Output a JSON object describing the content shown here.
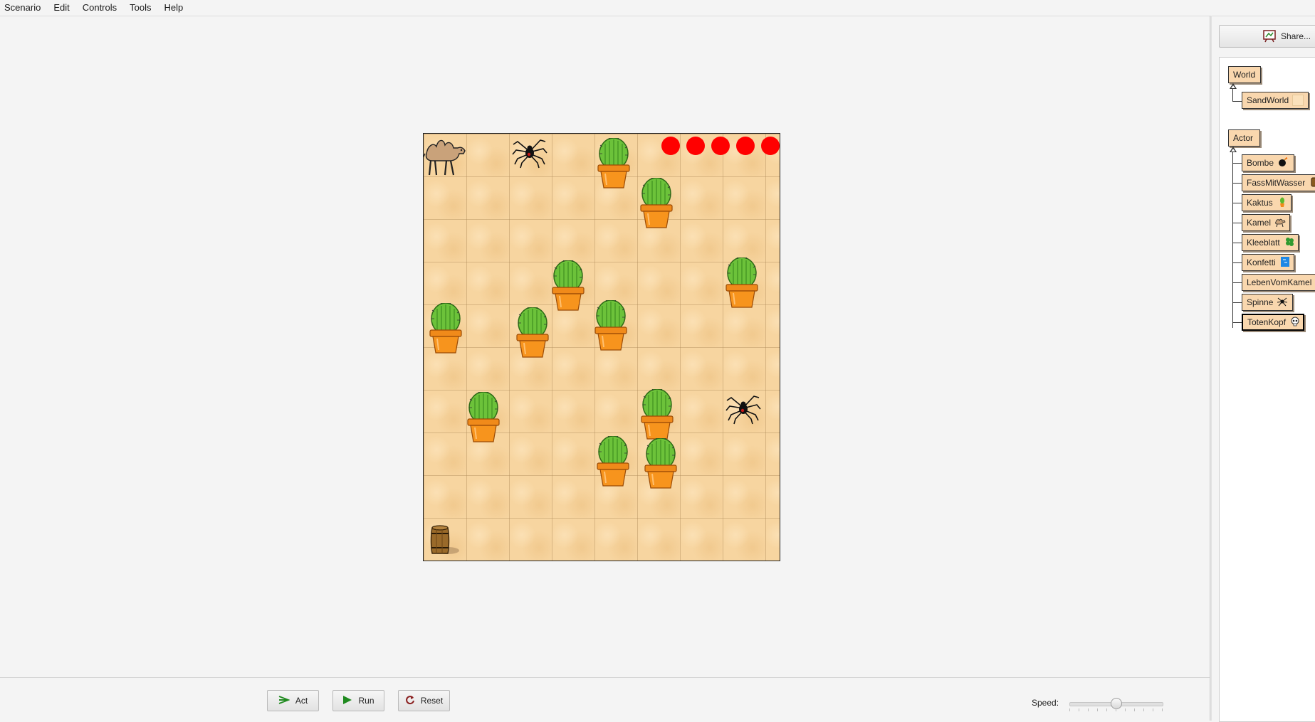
{
  "menu": [
    "Scenario",
    "Edit",
    "Controls",
    "Tools",
    "Help"
  ],
  "world": {
    "name": "SandWorld",
    "columns": 8,
    "rows": 10,
    "lives": 5,
    "actors": [
      {
        "type": "camel",
        "col": 0,
        "row": 0
      },
      {
        "type": "spider",
        "col": 2,
        "row": 0
      },
      {
        "type": "cactus",
        "col": 4,
        "row": 0
      },
      {
        "type": "cactus",
        "col": 5,
        "row": 1
      },
      {
        "type": "cactus",
        "col": 7,
        "row": 3
      },
      {
        "type": "cactus",
        "col": 3,
        "row": 3
      },
      {
        "type": "cactus",
        "col": 4,
        "row": 4
      },
      {
        "type": "cactus",
        "col": 0,
        "row": 4
      },
      {
        "type": "cactus",
        "col": 2,
        "row": 4
      },
      {
        "type": "cactus",
        "col": 1,
        "row": 6
      },
      {
        "type": "cactus",
        "col": 5,
        "row": 6
      },
      {
        "type": "spider",
        "col": 7,
        "row": 6
      },
      {
        "type": "cactus",
        "col": 4,
        "row": 7
      },
      {
        "type": "cactus",
        "col": 5,
        "row": 7
      },
      {
        "type": "barrel",
        "col": 0,
        "row": 9
      }
    ]
  },
  "share": {
    "label": "Share..."
  },
  "class_tree": {
    "world_root": "World",
    "world_subclasses": [
      {
        "name": "SandWorld",
        "icon": "sand-swatch-icon"
      }
    ],
    "actor_root": "Actor",
    "actor_subclasses": [
      {
        "name": "Bombe",
        "icon": "bomb-icon"
      },
      {
        "name": "FassMitWasser",
        "icon": "barrel-icon"
      },
      {
        "name": "Kaktus",
        "icon": "cactus-icon"
      },
      {
        "name": "Kamel",
        "icon": "camel-icon"
      },
      {
        "name": "Kleeblatt",
        "icon": "clover-icon"
      },
      {
        "name": "Konfetti",
        "icon": "confetti-icon"
      },
      {
        "name": "LebenVomKamel",
        "icon": ""
      },
      {
        "name": "Spinne",
        "icon": "spider-icon"
      },
      {
        "name": "TotenKopf",
        "icon": "skull-icon",
        "selected": true
      }
    ]
  },
  "controls": {
    "act": "Act",
    "run": "Run",
    "reset": "Reset",
    "speed_label": "Speed:",
    "speed_value": 0.5
  },
  "colors": {
    "sand": "#f7d5a0",
    "life": "#ff0000",
    "class_box": "#f9d7ae",
    "run_green": "#1f8a1f"
  }
}
